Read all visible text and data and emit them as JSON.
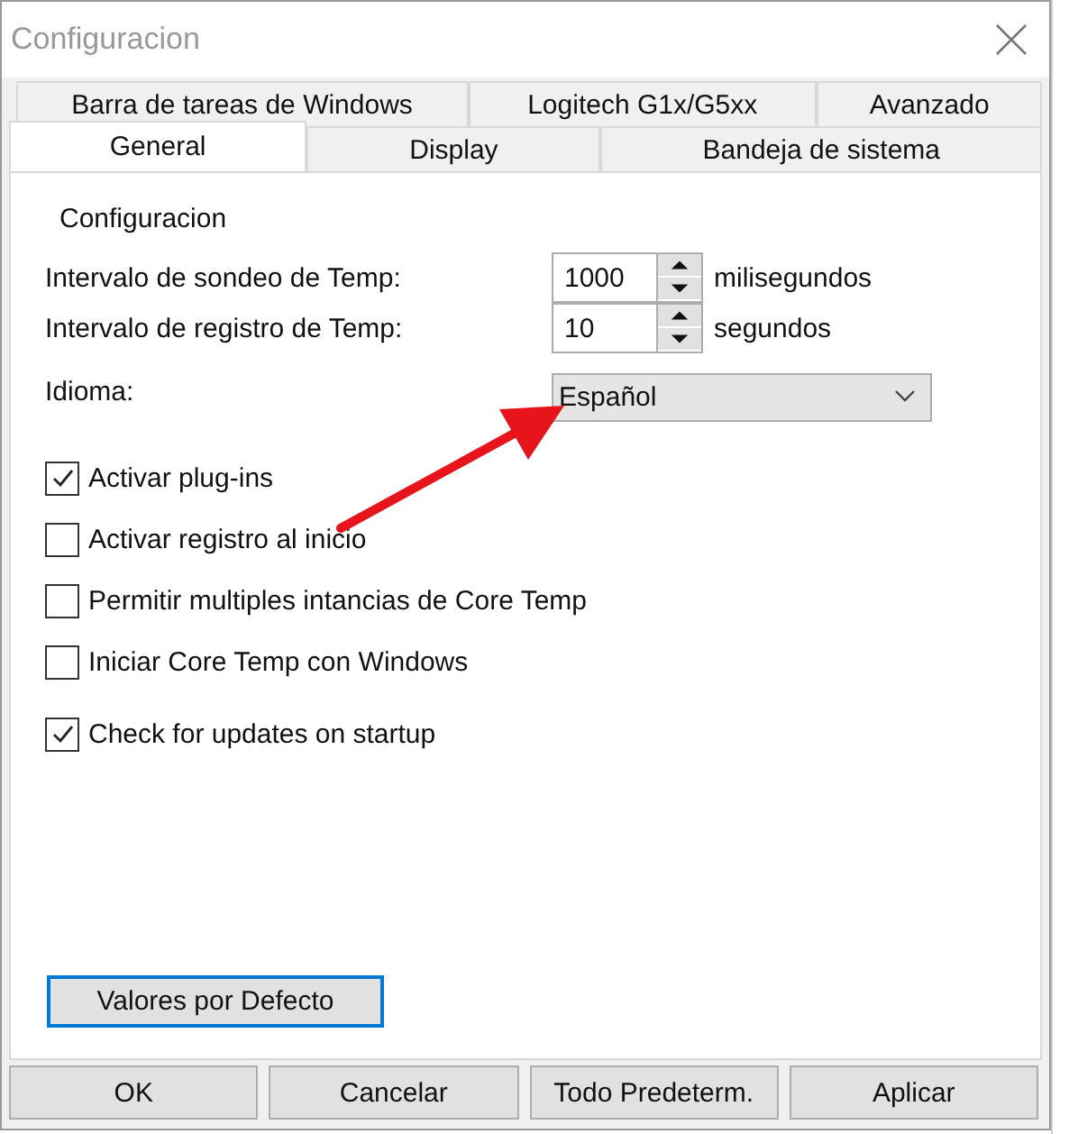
{
  "window": {
    "title": "Configuracion"
  },
  "tab_rows": [
    {
      "tabs": [
        {
          "label": "Barra de tareas de Windows",
          "selected": false
        },
        {
          "label": "Logitech G1x/G5xx",
          "selected": false
        },
        {
          "label": "Avanzado",
          "selected": false
        }
      ]
    },
    {
      "tabs": [
        {
          "label": "General",
          "selected": true
        },
        {
          "label": "Display",
          "selected": false
        },
        {
          "label": "Bandeja de sistema",
          "selected": false
        }
      ]
    }
  ],
  "group": {
    "title": "Configuracion"
  },
  "spin_fields": [
    {
      "label": "Intervalo de sondeo de Temp:",
      "value": "1000",
      "unit": "milisegundos"
    },
    {
      "label": "Intervalo de registro de Temp:",
      "value": "10",
      "unit": "segundos"
    }
  ],
  "language": {
    "label": "Idioma:",
    "value": "Español"
  },
  "checkboxes": [
    {
      "label": "Activar plug-ins",
      "checked": true
    },
    {
      "label": "Activar registro al inicio",
      "checked": false
    },
    {
      "label": "Permitir multiples intancias de Core Temp",
      "checked": false
    },
    {
      "label": "Iniciar Core Temp con Windows",
      "checked": false
    },
    {
      "label": "Check for updates on startup",
      "checked": true
    }
  ],
  "defaults_button": "Valores por Defecto",
  "buttons": [
    "OK",
    "Cancelar",
    "Todo Predeterm.",
    "Aplicar"
  ]
}
